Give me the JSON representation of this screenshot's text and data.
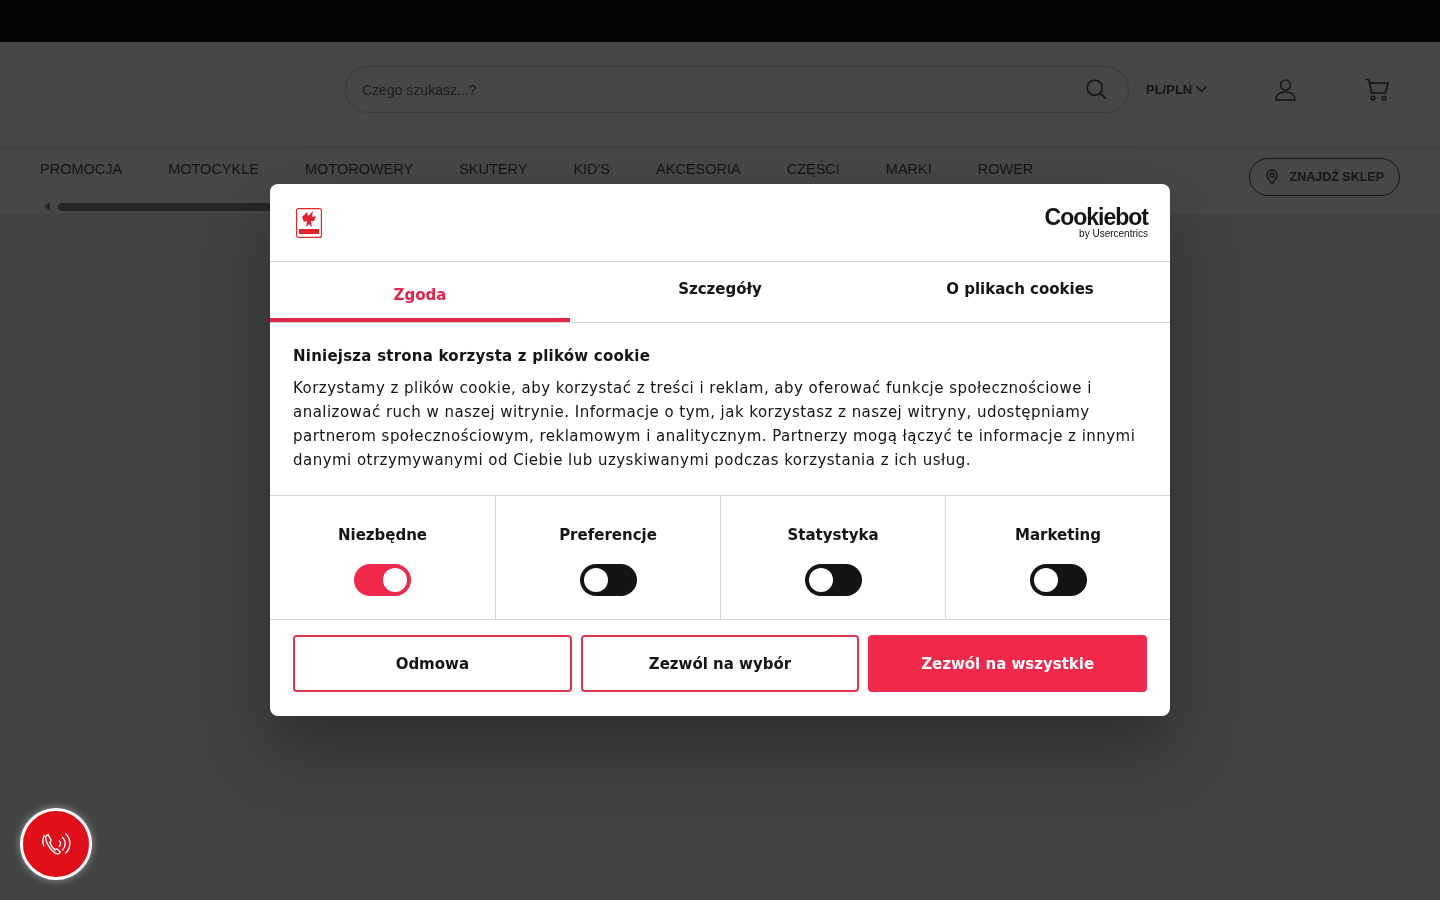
{
  "header": {
    "search": {
      "placeholder": "Czego szukasz...?"
    },
    "locale": "PL/PLN"
  },
  "nav": {
    "items": [
      "PROMOCJA",
      "MOTOCYKLE",
      "MOTOROWERY",
      "SKUTERY",
      "KID'S",
      "AKCESORIA",
      "CZĘŚCI",
      "MARKI",
      "ROWER"
    ],
    "store_button": "ZNAJDŹ SKLEP"
  },
  "cookie_dialog": {
    "brand": {
      "name": "Cookiebot",
      "tagline": "by Usercentrics"
    },
    "tabs": [
      {
        "label": "Zgoda",
        "selected": true
      },
      {
        "label": "Szczegóły",
        "selected": false
      },
      {
        "label": "O plikach cookies",
        "selected": false
      }
    ],
    "title": "Niniejsza strona korzysta z plików cookie",
    "body": "Korzystamy z plików cookie, aby korzystać z treści i reklam, aby oferować funkcje społecznościowe i analizować ruch w naszej witrynie. Informacje o tym, jak korzystasz z naszej witryny, udostępniamy partnerom społecznościowym, reklamowym i analitycznym. Partnerzy mogą łączyć te informacje z innymi danymi otrzymywanymi od Ciebie lub uzyskiwanymi podczas korzystania z ich usług.",
    "categories": [
      {
        "label": "Niezbędne",
        "on": true
      },
      {
        "label": "Preferencje",
        "on": false
      },
      {
        "label": "Statystyka",
        "on": false
      },
      {
        "label": "Marketing",
        "on": false
      }
    ],
    "buttons": [
      {
        "label": "Odmowa",
        "kind": "outline"
      },
      {
        "label": "Zezwól na wybór",
        "kind": "outline"
      },
      {
        "label": "Zezwól na wszystkie",
        "kind": "primary"
      }
    ]
  }
}
